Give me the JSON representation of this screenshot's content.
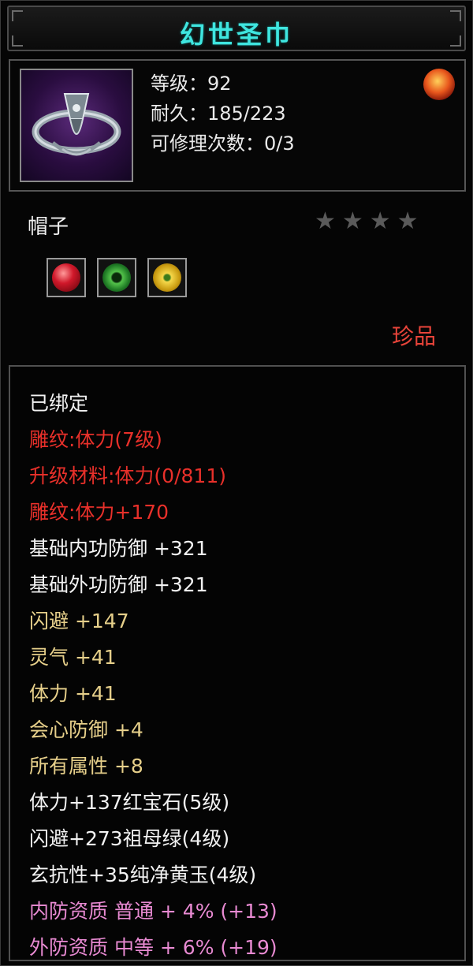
{
  "item": {
    "name": "幻世圣巾",
    "stats": {
      "level": "等级：92",
      "durability": "耐久：185/223",
      "repair": "可修理次数：0/3"
    },
    "type": "帽子",
    "stars": "★★★★",
    "rarity": "珍品",
    "gem_icons": [
      "ruby-gem-icon",
      "emerald-gem-icon",
      "topaz-gem-icon"
    ]
  },
  "attributes": [
    {
      "text": "已绑定",
      "color": "white"
    },
    {
      "text": "雕纹:体力(7级)",
      "color": "red"
    },
    {
      "text": "升级材料:体力(0/811)",
      "color": "red"
    },
    {
      "text": "雕纹:体力+170",
      "color": "red"
    },
    {
      "text": "基础内功防御  +321",
      "color": "white"
    },
    {
      "text": "基础外功防御  +321",
      "color": "white"
    },
    {
      "text": "闪避  +147",
      "color": "gold"
    },
    {
      "text": "灵气  +41",
      "color": "gold"
    },
    {
      "text": "体力  +41",
      "color": "gold"
    },
    {
      "text": "会心防御  +4",
      "color": "gold"
    },
    {
      "text": "所有属性  +8",
      "color": "gold"
    },
    {
      "text": "体力+137红宝石(5级)",
      "color": "white"
    },
    {
      "text": "闪避+273祖母绿(4级)",
      "color": "white"
    },
    {
      "text": "玄抗性+35纯净黄玉(4级)",
      "color": "white"
    },
    {
      "text": "内防资质  普通  + 4% (+13)",
      "color": "pink"
    },
    {
      "text": "外防资质  中等  + 6% (+19)",
      "color": "pink"
    }
  ],
  "colors": {
    "title": "#3fe6e0",
    "red": "#e8302a",
    "gold": "#e6cf8a",
    "pink": "#e88ad2",
    "white": "#f2f2f2"
  }
}
